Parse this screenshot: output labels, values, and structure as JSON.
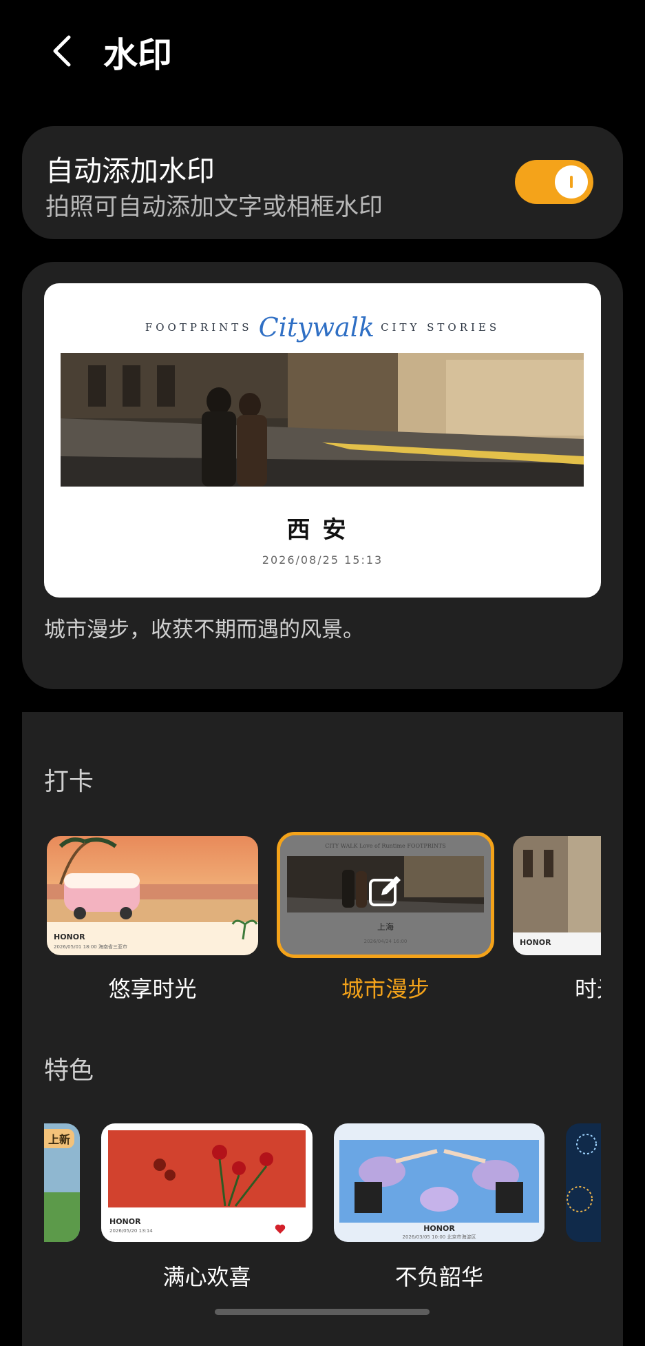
{
  "header": {
    "title": "水印",
    "back_icon": "chevron-left-icon"
  },
  "auto_watermark": {
    "title": "自动添加水印",
    "subtitle": "拍照可自动添加文字或相框水印",
    "enabled": true,
    "accent_color": "#f4a31a"
  },
  "preview": {
    "brand_left": "FOOTPRINTS",
    "brand_script": "Citywalk",
    "brand_right": "CITY STORIES",
    "city": "西安",
    "datetime": "2026/08/25 15:13",
    "description": "城市漫步，收获不期而遇的风景。"
  },
  "sections": {
    "checkin": {
      "title": "打卡",
      "items": [
        {
          "label": "悠享时光",
          "brand": "HONOR",
          "meta": "2026/05/01 18:00 海南省三亚市"
        },
        {
          "label": "城市漫步",
          "selected": true,
          "city": "上海",
          "meta": "2026/04/24 16:00"
        },
        {
          "label": "时光",
          "brand": "HONOR"
        }
      ]
    },
    "featured": {
      "title": "特色",
      "items": [
        {
          "badge": "上新"
        },
        {
          "label": "满心欢喜",
          "brand": "HONOR",
          "meta": "2026/05/20 13:14"
        },
        {
          "label": "不负韶华",
          "brand": "HONOR",
          "meta": "2026/03/05 10:00 北京市海淀区"
        },
        {
          "label": ""
        }
      ]
    }
  }
}
